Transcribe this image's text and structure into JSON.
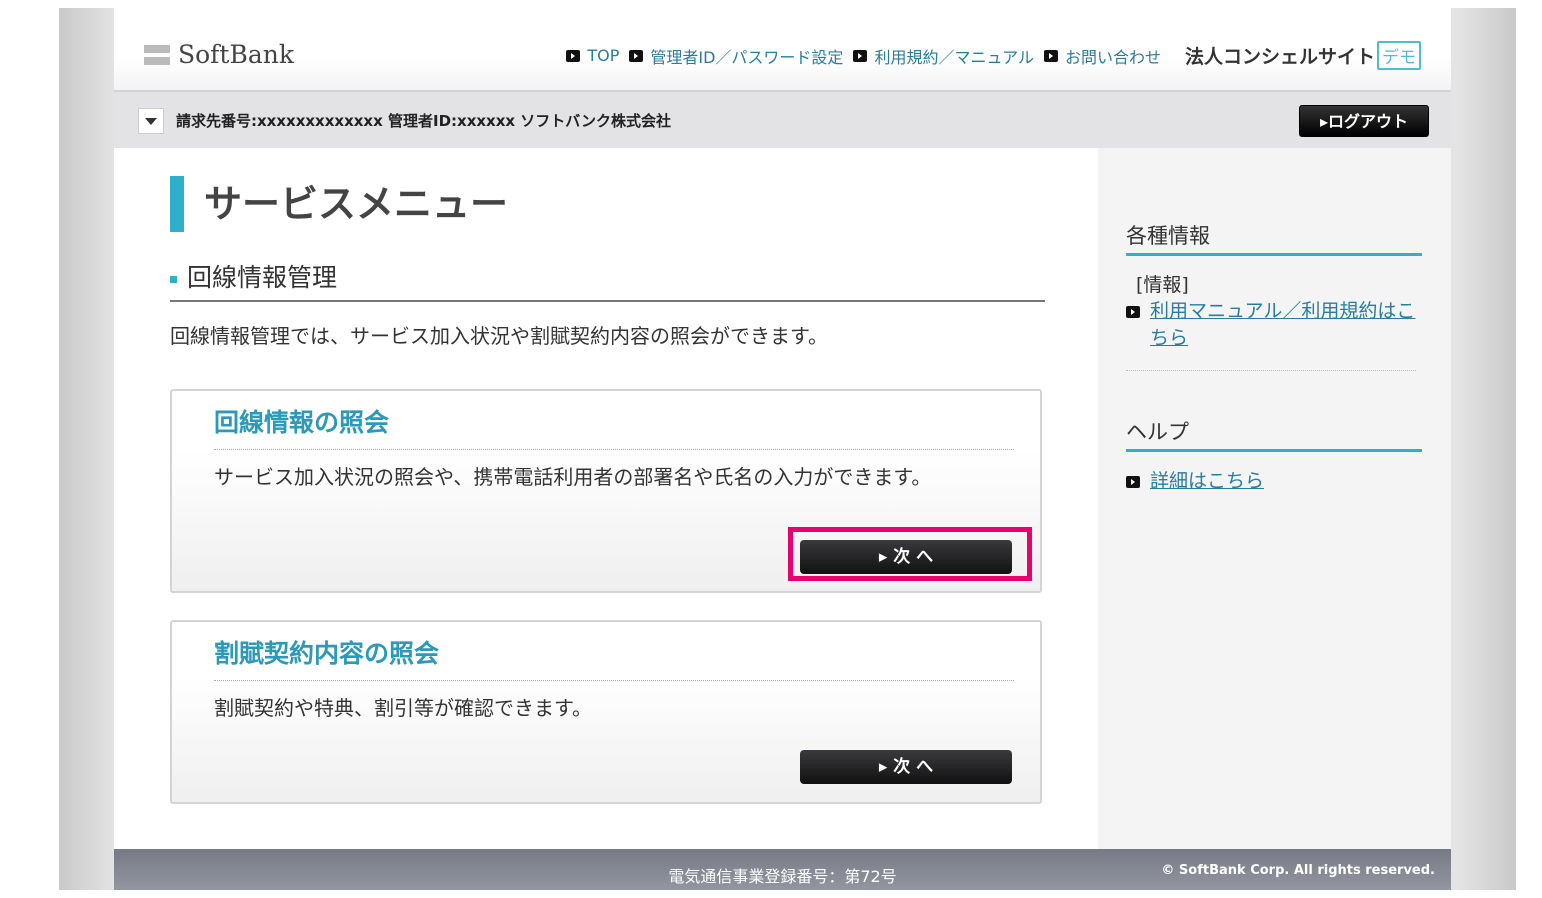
{
  "header": {
    "logo": "SoftBank",
    "nav": [
      "TOP",
      "管理者ID／パスワード設定",
      "利用規約／マニュアル",
      "お問い合わせ"
    ],
    "site_title": "法人コンシェルサイト",
    "demo_badge": "デモ"
  },
  "account": {
    "info": "請求先番号:xxxxxxxxxxxxx 管理者ID:xxxxxx ソフトバンク株式会社",
    "logout": "▸ログアウト"
  },
  "main": {
    "title": "サービスメニュー",
    "section": "回線情報管理",
    "description": "回線情報管理では、サービス加入状況や割賦契約内容の照会ができます。",
    "cards": [
      {
        "title": "回線情報の照会",
        "text": "サービス加入状況の照会や、携帯電話利用者の部署名や氏名の入力ができます。",
        "button": "▸ 次 へ"
      },
      {
        "title": "割賦契約内容の照会",
        "text": "割賦契約や特典、割引等が確認できます。",
        "button": "▸ 次 へ"
      }
    ]
  },
  "sidebar": {
    "info_heading": "各種情報",
    "info_label": "[情報]",
    "info_link": "利用マニュアル／利用規約はこちら",
    "help_heading": "ヘルプ",
    "help_link": "詳細はこちら"
  },
  "footer": {
    "registration": "電気通信事業登録番号：第72号",
    "copyright": "© SoftBank Corp. All rights reserved."
  },
  "colors": {
    "accent": "#2eb0cb",
    "highlight": "#e8006e"
  }
}
